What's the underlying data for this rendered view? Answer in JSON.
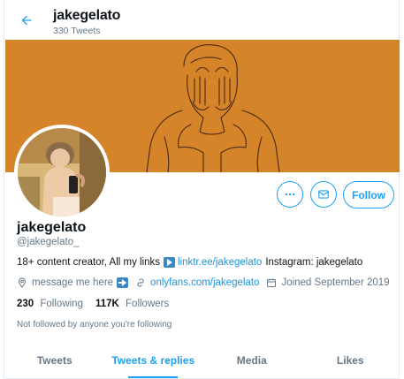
{
  "header": {
    "back_icon": "arrow-left-icon",
    "name": "jakegelato",
    "tweet_count": "330 Tweets"
  },
  "colors": {
    "banner": "#d6842a",
    "accent": "#1da1f2",
    "link": "#1b95e0",
    "muted": "#657786"
  },
  "profile": {
    "display_name": "jakegelato",
    "handle": "@jakegelato_",
    "bio": {
      "prefix": "18+ content creator, All my links",
      "link": "linktr.ee/jakegelato",
      "suffix": "Instagram: jakegelato"
    },
    "location": "message me here",
    "website": "onlyfans.com/jakegelato",
    "joined": "Joined September 2019",
    "following_count": "230",
    "following_label": "Following",
    "followers_count": "117K",
    "followers_label": "Followers",
    "followed_by": "Not followed by anyone you're following"
  },
  "actions": {
    "more_icon": "more-dots-icon",
    "message_icon": "envelope-icon",
    "follow_label": "Follow"
  },
  "tabs": [
    {
      "label": "Tweets",
      "active": false
    },
    {
      "label": "Tweets & replies",
      "active": true
    },
    {
      "label": "Media",
      "active": false
    },
    {
      "label": "Likes",
      "active": false
    }
  ]
}
